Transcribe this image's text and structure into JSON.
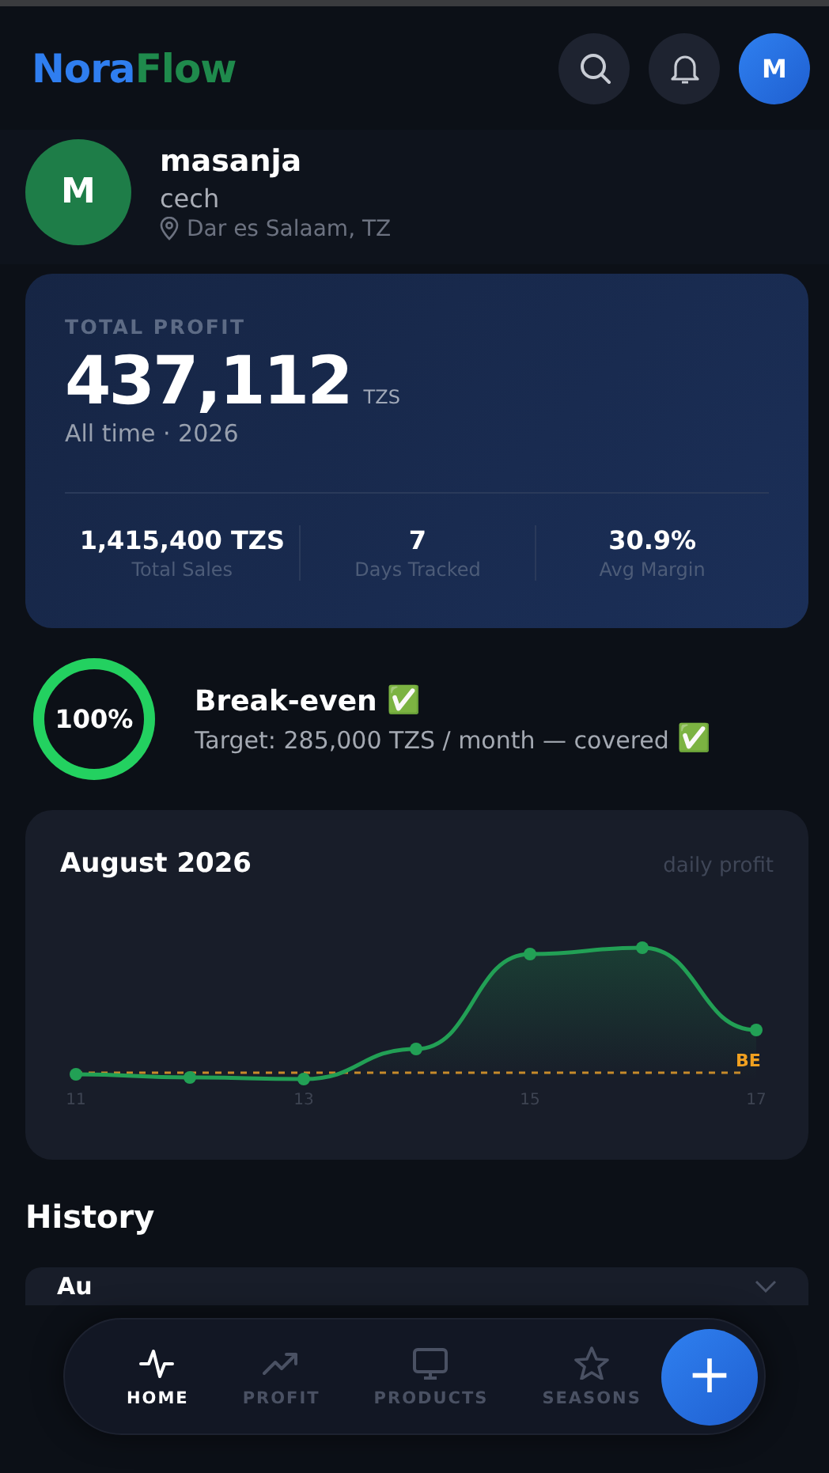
{
  "header": {
    "logo": [
      {
        "text": "Nora",
        "kind": "primary"
      },
      {
        "text": "Flow",
        "kind": "accent"
      }
    ],
    "avatar": "M"
  },
  "profile": {
    "initial": "M",
    "name": "masanja",
    "subtitle": "cech",
    "location": "Dar es Salaam, TZ"
  },
  "profit_card": {
    "label": "TOTAL PROFIT",
    "amount": "437,112",
    "currency": "TZS",
    "period": "All time · 2026",
    "stats": [
      {
        "value": "1,415,400 TZS",
        "label": "Total Sales"
      },
      {
        "value": "7",
        "label": "Days Tracked"
      },
      {
        "value": "30.9%",
        "label": "Avg Margin"
      }
    ]
  },
  "breakeven": {
    "level": 1,
    "percent": "100%",
    "title": "Break-even",
    "title_mark": "✅",
    "target": "Target: 285,000 TZS / month — covered",
    "target_mark": "✅"
  },
  "chart_card": {
    "title": "August 2026",
    "caption": "daily profit",
    "x_labels": [
      "11",
      "13",
      "15",
      "17"
    ],
    "line_label": "BE"
  },
  "history": {
    "title": "History",
    "rows": [
      {
        "label": "Au"
      }
    ]
  },
  "nav": {
    "items": [
      {
        "label": "HOME",
        "kind": "pulse",
        "selected": true
      },
      {
        "label": "PROFIT",
        "kind": "trend",
        "selected": false
      },
      {
        "label": "PRODUCTS",
        "kind": "monitor",
        "selected": false
      },
      {
        "label": "SEASONS",
        "kind": "star",
        "selected": false
      }
    ],
    "fab": "+"
  }
}
